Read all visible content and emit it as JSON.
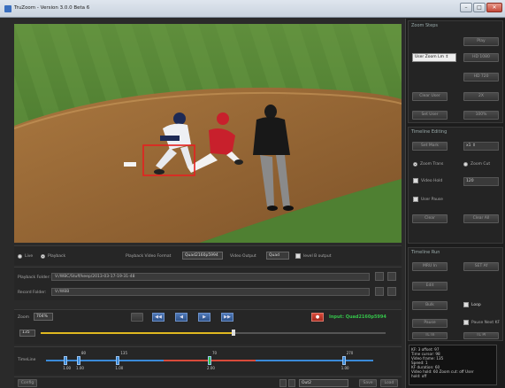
{
  "window": {
    "title": "TruZoom - Version 3.0.0 Beta 6"
  },
  "zoom_steps": {
    "title": "Zoom Steps",
    "buttons": [
      "Play",
      "HD 1080",
      "HD 720",
      "2X",
      "100%"
    ],
    "user_zoom_select": "User Zoom Lm",
    "clear_user": "Clear User",
    "set_user": "Set User"
  },
  "timeline_editing": {
    "title": "Timeline Editing",
    "set_mark": "Set Mark",
    "mark_select": "x1",
    "zoom_trans": "Zoom Trans",
    "zoom_cut": "Zoom Cut",
    "video_hold": "Video Hold",
    "hold_value": "120",
    "user_pause": "User Pause",
    "clear": "Clear",
    "clear_all": "Clear All"
  },
  "timeline_run": {
    "title": "Timeline Run",
    "buttons": [
      "MRU In",
      "SET Af",
      "Edit",
      "Bulk",
      "Pause",
      "TL In",
      "TL Pl"
    ],
    "loop": "Loop",
    "pause_next": "Pause Next KF"
  },
  "status": {
    "lines": [
      "KF: 3 offset: 97",
      "Time cursor: 98",
      "Video frame: 135",
      "Speed: 1",
      "KF duration: 60",
      "Video hold: 60 Zoom cut: off User",
      "hold: off"
    ]
  },
  "source": {
    "live": "Live",
    "playback": "Playback",
    "playback_video_format_label": "Playback Video Format",
    "playback_video_format": "Quad2160p5994",
    "video_output_label": "Video Output",
    "video_output": "Quad",
    "level_b_output": "level B output"
  },
  "playback_folder": {
    "label": "Playback Folder:",
    "value": "V:/WBC/Stuff/keep/2013-03-17-19-31-48"
  },
  "record_folder": {
    "label": "Record Folder:",
    "value": "V:/WBB"
  },
  "zoom": {
    "label": "Zoom",
    "value": "704%"
  },
  "input_label": "Input: Quad2160p5994",
  "scrub": {
    "value": "135",
    "progress": 0.56
  },
  "timeline": {
    "label": "TimeLine",
    "markers": [
      {
        "pos": 0.06,
        "top": "",
        "bottom": "1.00"
      },
      {
        "pos": 0.1,
        "top": "80",
        "bottom": "1.00"
      },
      {
        "pos": 0.22,
        "top": "135",
        "bottom": "1.00"
      },
      {
        "pos": 0.5,
        "top": "70",
        "bottom": "2.00"
      },
      {
        "pos": 0.91,
        "top": "270",
        "bottom": "1.00"
      }
    ]
  },
  "bottom_bar": {
    "config": "Config",
    "out_field": "Out2",
    "save": "Save",
    "load": "Load"
  },
  "colors": {
    "accent_blue": "#4e78b8",
    "record_red": "#d84a3a",
    "input_green": "#35c24a",
    "scrub_yellow": "#e0b820"
  }
}
